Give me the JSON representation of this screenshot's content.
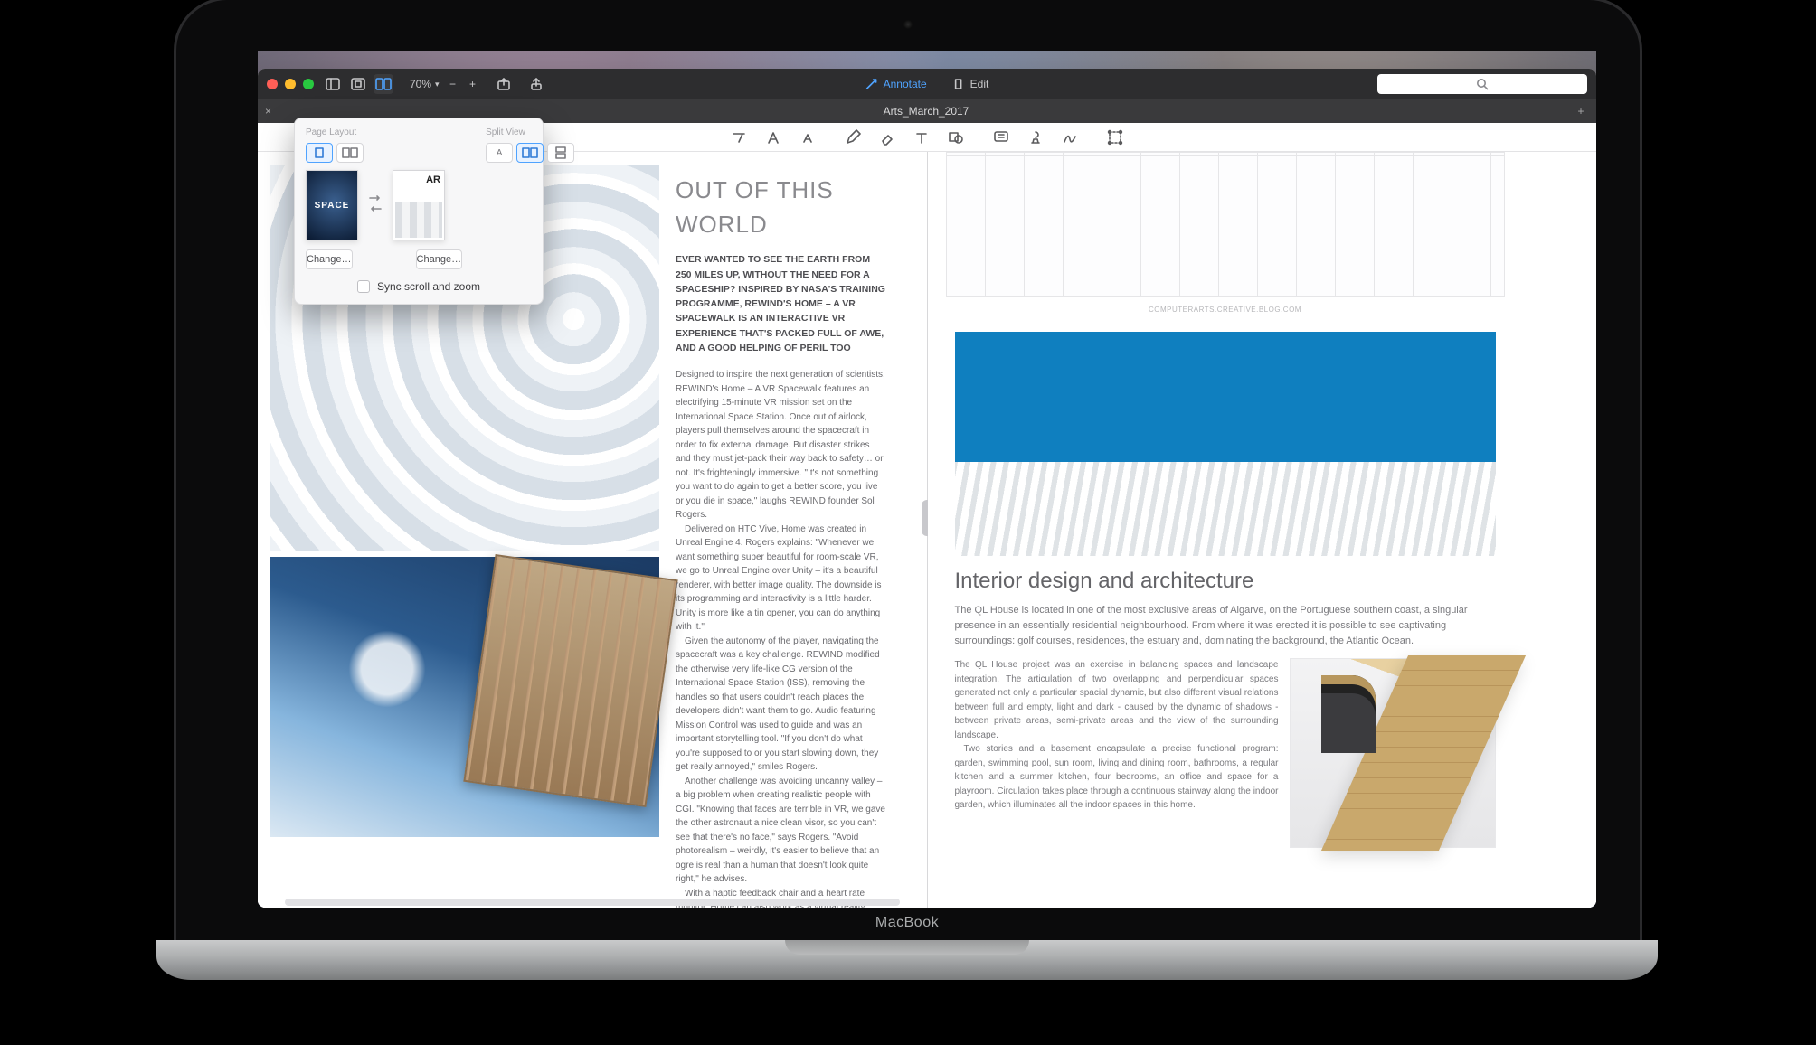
{
  "device": {
    "brand": "MacBook"
  },
  "titlebar": {
    "zoom": "70%",
    "annotate": "Annotate",
    "edit": "Edit"
  },
  "tab": {
    "title": "Arts_March_2017"
  },
  "popover": {
    "page_layout_label": "Page Layout",
    "split_view_label": "Split View",
    "thumb_left": "SPACE",
    "thumb_right": "AR",
    "change": "Change…",
    "sync": "Sync scroll and zoom"
  },
  "left_doc": {
    "title": "OUT OF THIS WORLD",
    "lead": "EVER WANTED TO SEE THE EARTH FROM 250 MILES UP, WITHOUT THE NEED FOR A SPACESHIP? INSPIRED BY NASA'S TRAINING PROGRAMME, REWIND'S HOME – A VR SPACEWALK IS AN INTERACTIVE VR EXPERIENCE THAT'S PACKED FULL OF AWE, AND A GOOD HELPING OF PERIL TOO",
    "body1": "Designed to inspire the next generation of scientists, REWIND's Home – A VR Spacewalk features an electrifying 15-minute VR mission set on the International Space Station. Once out of airlock, players pull themselves around the spacecraft in order to fix external damage. But disaster strikes and they must jet-pack their way back to safety… or not. It's frighteningly immersive. \"It's not something you want to do again to get a better score, you live or you die in space,\" laughs REWIND founder Sol Rogers.",
    "body2": "Delivered on HTC Vive, Home was created in Unreal Engine 4. Rogers explains: \"Whenever we want something super beautiful for room-scale VR, we go to Unreal Engine over Unity – it's a beautiful renderer, with better image quality. The downside is its programming and interactivity is a little harder. Unity is more like a tin opener, you can do anything with it.\"",
    "body3": "Given the autonomy of the player, navigating the spacecraft was a key challenge. REWIND modified the otherwise very life-like CG version of the International Space Station (ISS), removing the handles so that users couldn't reach places the developers didn't want them to go. Audio featuring Mission Control was used to guide and was an important storytelling tool. \"If you don't do what you're supposed to or you start slowing down, they get really annoyed,\" smiles Rogers.",
    "body4": "Another challenge was avoiding uncanny valley – a big problem when creating realistic people with CGI. \"Knowing that faces are terrible in VR, we gave the other astronaut a nice clean visor, so you can't see that there's no face,\" says Rogers. \"Avoid photorealism – weirdly, it's easier to believe that an ogre is real than a human that doesn't look quite right,\" he advises.",
    "body5": "With a haptic feedback chair and a heart rate monitor, Home can also work as a virtual reality installation that feeds back the users' own"
  },
  "right_doc": {
    "elev_caption": "COMPUTERARTS.CREATIVE.BLOG.COM",
    "heading": "Interior design and architecture",
    "p1": "The QL House is located in one of the most exclusive areas of Algarve, on the Portuguese southern coast, a singular presence in an essentially residential neighbourhood. From where it was erected it is possible to see captivating surroundings: golf courses, residences, the estuary and, dominating the background, the Atlantic Ocean.",
    "p2": "The QL House project was an exercise in balancing spaces and landscape integration. The articulation of two overlapping and perpendicular spaces generated not only a particular spacial dynamic, but also different visual relations between full and empty, light and dark - caused by the dynamic of shadows - between private areas, semi-private areas and the view of the surrounding landscape.",
    "p3": "Two stories and a basement encapsulate a precise functional program: garden, swimming pool, sun room, living and dining room, bathrooms, a regular kitchen and a summer kitchen, four bedrooms, an office and space for a playroom. Circulation takes place through a continuous stairway along the indoor garden, which illuminates all the indoor spaces in this home."
  }
}
